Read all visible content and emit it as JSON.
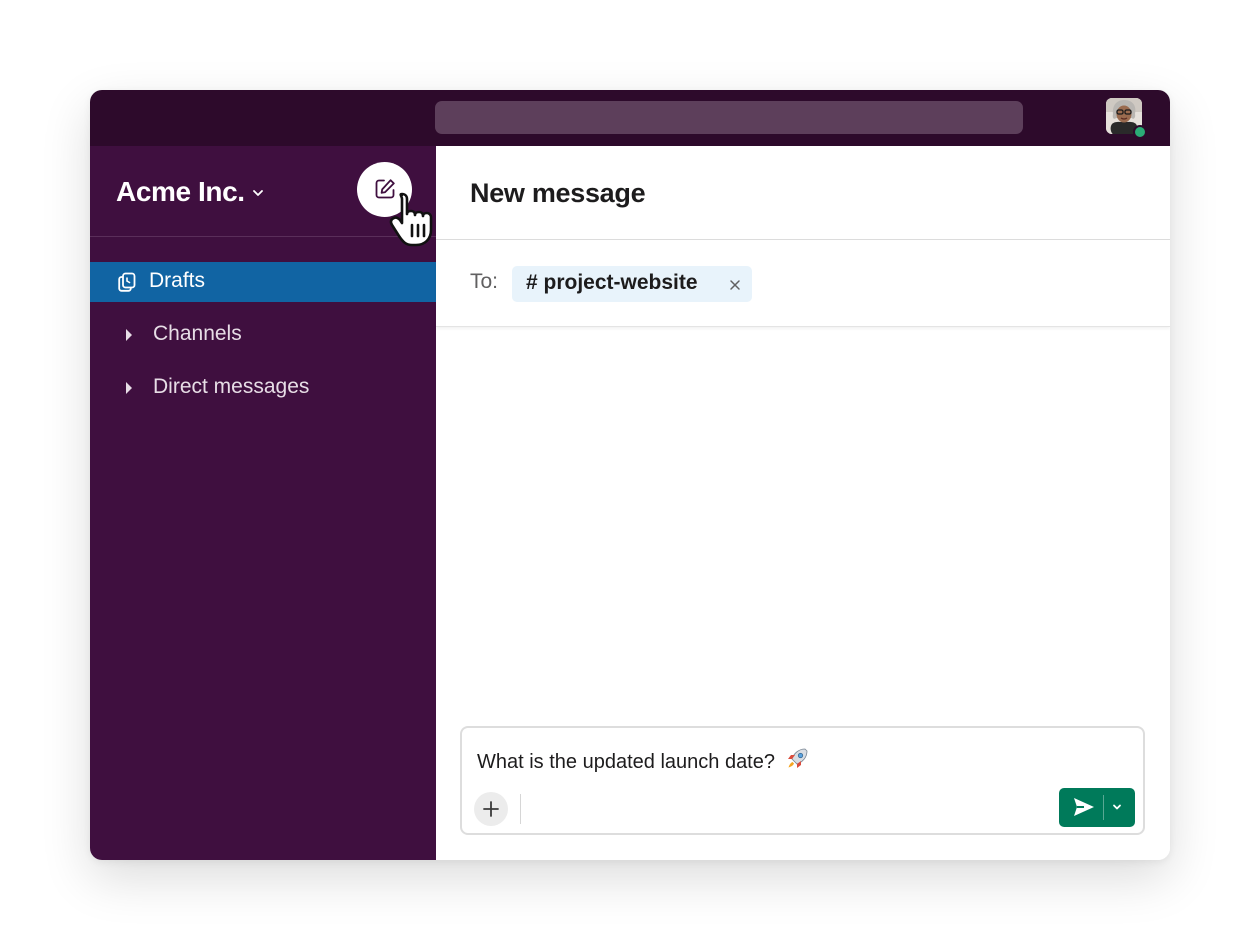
{
  "topbar": {
    "search_placeholder": "",
    "avatar_icon": "user-avatar-icon",
    "presence_color": "#2bac76"
  },
  "sidebar": {
    "workspace_name": "Acme Inc.",
    "compose_icon": "compose-icon",
    "items": [
      {
        "label": "Drafts",
        "icon": "drafts-icon",
        "active": true
      },
      {
        "label": "Channels",
        "icon": "caret-right-icon",
        "active": false
      },
      {
        "label": "Direct messages",
        "icon": "caret-right-icon",
        "active": false
      }
    ]
  },
  "main": {
    "title": "New message",
    "to_label": "To:",
    "recipient": "# project-website",
    "composer": {
      "text": "What is the updated launch date?",
      "emoji_icon": "rocket-icon"
    },
    "send_icon": "send-icon"
  },
  "colors": {
    "topbar": "#2d0a2b",
    "sidebar": "#3f0f3f",
    "active_item": "#1164a3",
    "send_button": "#007a5a",
    "chip": "#e8f3fb"
  }
}
